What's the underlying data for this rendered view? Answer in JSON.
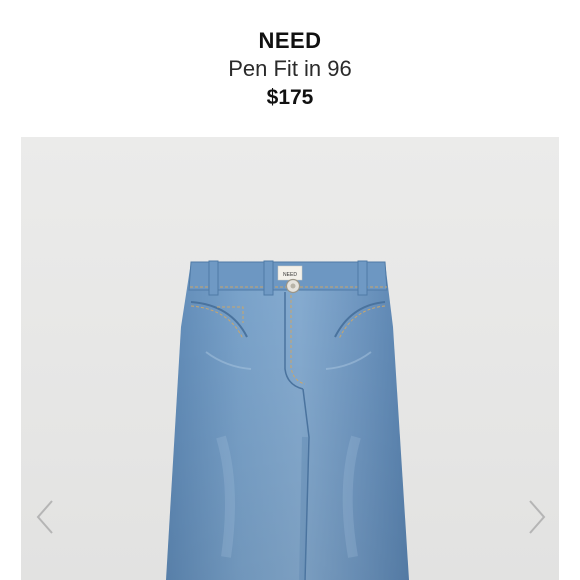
{
  "product": {
    "brand": "NEED",
    "name": "Pen Fit in 96",
    "price": "$175"
  },
  "gallery": {
    "image_subject": "jeans-photo",
    "label_text": "NEED"
  },
  "icons": {
    "prev": "chevron-left-icon",
    "next": "chevron-right-icon"
  },
  "colors": {
    "denim": "#6f98c2",
    "background": "#e8e8e7"
  }
}
